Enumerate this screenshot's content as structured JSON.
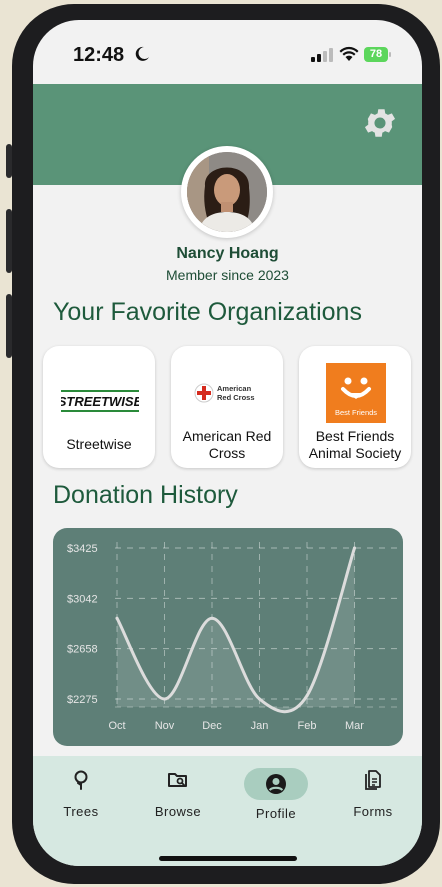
{
  "status_bar": {
    "time": "12:48",
    "battery": "78"
  },
  "profile": {
    "name": "Nancy Hoang",
    "member_since": "Member since 2023"
  },
  "favorites": {
    "title": "Your Favorite Organizations",
    "items": [
      {
        "name": "Streetwise",
        "logo_text": "STREETWISE"
      },
      {
        "name": "American Red Cross",
        "logo_text": "American Red Cross"
      },
      {
        "name": "Best Friends Animal Society",
        "logo_text": "Best Friends"
      }
    ]
  },
  "donation_history": {
    "title": "Donation History"
  },
  "chart_data": {
    "type": "line",
    "categories": [
      "Oct",
      "Nov",
      "Dec",
      "Jan",
      "Feb",
      "Mar"
    ],
    "values": [
      2890,
      2275,
      2890,
      2275,
      2300,
      3425
    ],
    "yticks": [
      "$3425",
      "$3042",
      "$2658",
      "$2275"
    ],
    "ylim": [
      2275,
      3425
    ],
    "grid": true,
    "line_color": "#dcdcdc",
    "background": "#5e7f77"
  },
  "tabs": [
    {
      "label": "Trees",
      "icon": "tree-icon"
    },
    {
      "label": "Browse",
      "icon": "folder-search-icon"
    },
    {
      "label": "Profile",
      "icon": "user-circle-icon",
      "active": true
    },
    {
      "label": "Forms",
      "icon": "document-icon"
    }
  ],
  "colors": {
    "accent": "#5a9478",
    "heading": "#1e5a3c",
    "tabbar": "#d6e8e1"
  }
}
